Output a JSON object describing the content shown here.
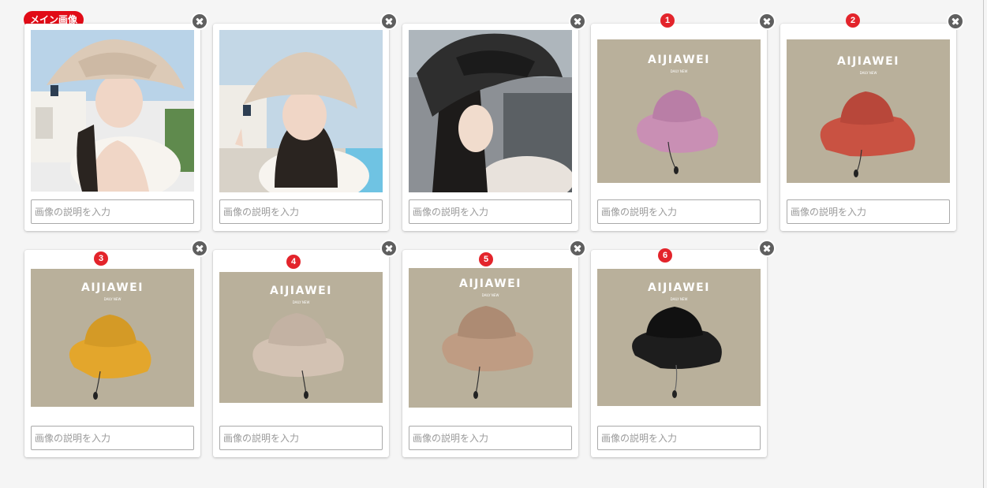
{
  "main_badge": "メイン画像",
  "description_placeholder": "画像の説明を入力",
  "product_brand": "AIJIAWEI",
  "product_sub": "DAILY NEW",
  "images": [
    {
      "label": "",
      "kind": "photo",
      "hat_color": "#dccab7"
    },
    {
      "label": "",
      "kind": "photo",
      "hat_color": "#dccab7"
    },
    {
      "label": "",
      "kind": "photo",
      "hat_color": "#2e2e2e"
    },
    {
      "label": "1",
      "kind": "product",
      "hat_color": "#c98fb4"
    },
    {
      "label": "2",
      "kind": "product",
      "hat_color": "#c95242"
    },
    {
      "label": "3",
      "kind": "product",
      "hat_color": "#e3a62c"
    },
    {
      "label": "4",
      "kind": "product",
      "hat_color": "#d3c2b3"
    },
    {
      "label": "5",
      "kind": "product",
      "hat_color": "#bf9c83"
    },
    {
      "label": "6",
      "kind": "product",
      "hat_color": "#1d1d1d"
    }
  ],
  "colors": {
    "accent_red": "#e3242b",
    "main_badge_red": "#e10b17",
    "product_bg": "#b9b09b"
  }
}
